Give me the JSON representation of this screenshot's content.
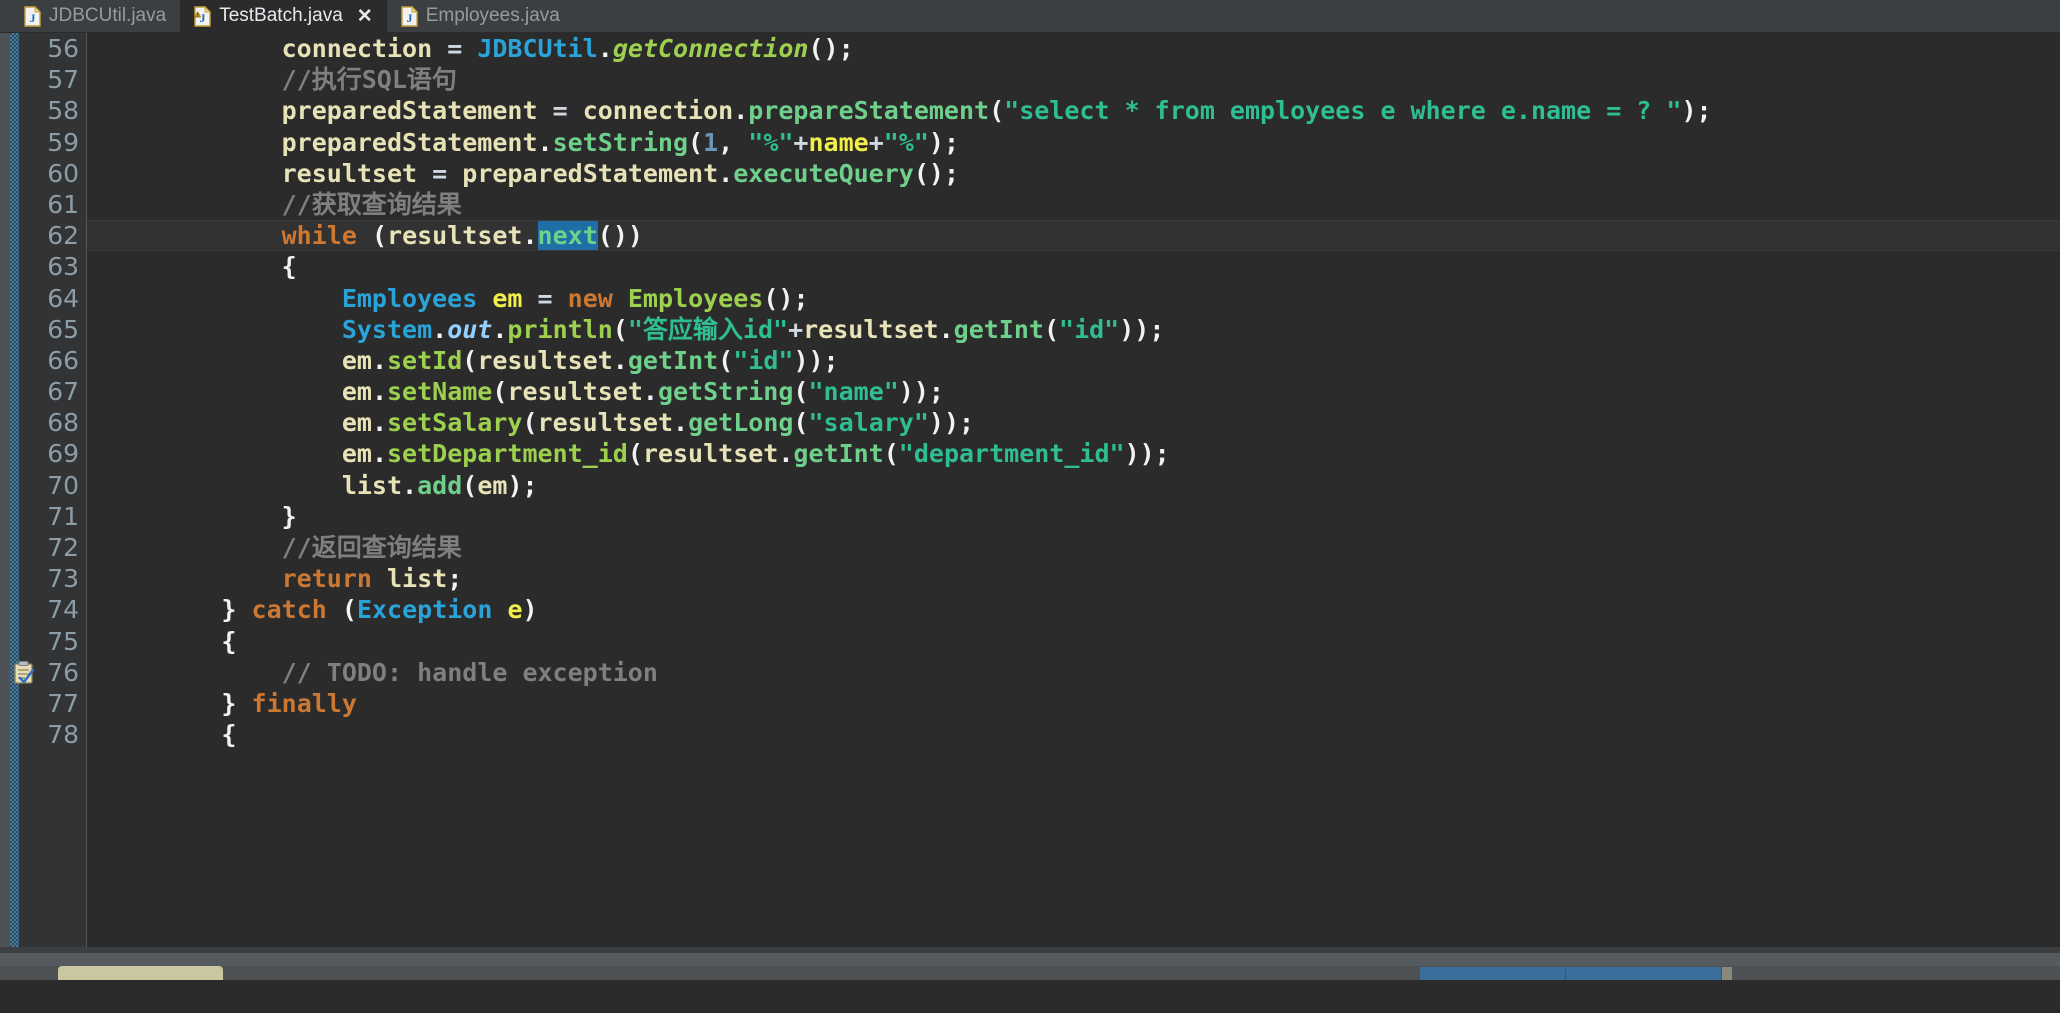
{
  "window": {
    "kind": "java-ide-editor",
    "background": "#2b2b2b"
  },
  "tabs": [
    {
      "label": "JDBCUtil.java",
      "icon": "java-file-icon",
      "active": false,
      "warning": false,
      "closable": false
    },
    {
      "label": "TestBatch.java",
      "icon": "java-file-warning-icon",
      "active": true,
      "warning": true,
      "closable": true,
      "close_label": "✕"
    },
    {
      "label": "Employees.java",
      "icon": "java-file-icon",
      "active": false,
      "warning": false,
      "closable": false
    }
  ],
  "gutter": {
    "first_line": 56,
    "last_line": 78,
    "lines": [
      "56",
      "57",
      "58",
      "59",
      "60",
      "61",
      "62",
      "63",
      "64",
      "65",
      "66",
      "67",
      "68",
      "69",
      "70",
      "71",
      "72",
      "73",
      "74",
      "75",
      "76",
      "77",
      "78"
    ],
    "todo_marker_line": "76"
  },
  "editor": {
    "caret_line": "62",
    "selection_text": "next",
    "language": "Java",
    "lines": [
      {
        "n": "56",
        "tokens": [
          {
            "t": "            ",
            "c": "plain"
          },
          {
            "t": "connection",
            "c": "var"
          },
          {
            "t": " ",
            "c": "plain"
          },
          {
            "t": "=",
            "c": "op"
          },
          {
            "t": " ",
            "c": "plain"
          },
          {
            "t": "JDBCUtil",
            "c": "cls"
          },
          {
            "t": ".",
            "c": "punc"
          },
          {
            "t": "getConnection",
            "c": "meth-italic"
          },
          {
            "t": "();",
            "c": "punc"
          }
        ]
      },
      {
        "n": "57",
        "tokens": [
          {
            "t": "            ",
            "c": "plain"
          },
          {
            "t": "//执行SQL语句",
            "c": "cmt"
          }
        ]
      },
      {
        "n": "58",
        "tokens": [
          {
            "t": "            ",
            "c": "plain"
          },
          {
            "t": "preparedStatement",
            "c": "var"
          },
          {
            "t": " ",
            "c": "plain"
          },
          {
            "t": "=",
            "c": "op"
          },
          {
            "t": " ",
            "c": "plain"
          },
          {
            "t": "connection",
            "c": "var"
          },
          {
            "t": ".",
            "c": "punc"
          },
          {
            "t": "prepareStatement",
            "c": "mcall"
          },
          {
            "t": "(",
            "c": "punc"
          },
          {
            "t": "\"select * from employees e where e.name = ? \"",
            "c": "str"
          },
          {
            "t": ");",
            "c": "punc"
          }
        ]
      },
      {
        "n": "59",
        "tokens": [
          {
            "t": "            ",
            "c": "plain"
          },
          {
            "t": "preparedStatement",
            "c": "var"
          },
          {
            "t": ".",
            "c": "punc"
          },
          {
            "t": "setString",
            "c": "mcall"
          },
          {
            "t": "(",
            "c": "punc"
          },
          {
            "t": "1",
            "c": "num"
          },
          {
            "t": ", ",
            "c": "punc"
          },
          {
            "t": "\"%\"",
            "c": "str"
          },
          {
            "t": "+",
            "c": "op"
          },
          {
            "t": "name",
            "c": "param"
          },
          {
            "t": "+",
            "c": "op"
          },
          {
            "t": "\"%\"",
            "c": "str"
          },
          {
            "t": ");",
            "c": "punc"
          }
        ]
      },
      {
        "n": "60",
        "tokens": [
          {
            "t": "            ",
            "c": "plain"
          },
          {
            "t": "resultset",
            "c": "var"
          },
          {
            "t": " ",
            "c": "plain"
          },
          {
            "t": "=",
            "c": "op"
          },
          {
            "t": " ",
            "c": "plain"
          },
          {
            "t": "preparedStatement",
            "c": "var"
          },
          {
            "t": ".",
            "c": "punc"
          },
          {
            "t": "executeQuery",
            "c": "mcall"
          },
          {
            "t": "();",
            "c": "punc"
          }
        ]
      },
      {
        "n": "61",
        "tokens": [
          {
            "t": "            ",
            "c": "plain"
          },
          {
            "t": "//获取查询结果",
            "c": "cmt"
          }
        ]
      },
      {
        "n": "62",
        "caret": true,
        "tokens": [
          {
            "t": "            ",
            "c": "plain"
          },
          {
            "t": "while",
            "c": "kw"
          },
          {
            "t": " ",
            "c": "plain"
          },
          {
            "t": "(",
            "c": "punc"
          },
          {
            "t": "resultset",
            "c": "var"
          },
          {
            "t": ".",
            "c": "punc"
          },
          {
            "t": "next",
            "c": "selected"
          },
          {
            "t": "())",
            "c": "punc"
          }
        ]
      },
      {
        "n": "63",
        "tokens": [
          {
            "t": "            ",
            "c": "plain"
          },
          {
            "t": "{",
            "c": "punc"
          }
        ]
      },
      {
        "n": "64",
        "tokens": [
          {
            "t": "                ",
            "c": "plain"
          },
          {
            "t": "Employees",
            "c": "cls"
          },
          {
            "t": " ",
            "c": "plain"
          },
          {
            "t": "em",
            "c": "param"
          },
          {
            "t": " ",
            "c": "plain"
          },
          {
            "t": "=",
            "c": "op"
          },
          {
            "t": " ",
            "c": "plain"
          },
          {
            "t": "new",
            "c": "kw"
          },
          {
            "t": " ",
            "c": "plain"
          },
          {
            "t": "Employees",
            "c": "meth"
          },
          {
            "t": "();",
            "c": "punc"
          }
        ]
      },
      {
        "n": "65",
        "tokens": [
          {
            "t": "                ",
            "c": "plain"
          },
          {
            "t": "System",
            "c": "cls"
          },
          {
            "t": ".",
            "c": "punc"
          },
          {
            "t": "out",
            "c": "stat"
          },
          {
            "t": ".",
            "c": "punc"
          },
          {
            "t": "println",
            "c": "meth"
          },
          {
            "t": "(",
            "c": "punc"
          },
          {
            "t": "\"答应输入id\"",
            "c": "str"
          },
          {
            "t": "+",
            "c": "op"
          },
          {
            "t": "resultset",
            "c": "var"
          },
          {
            "t": ".",
            "c": "punc"
          },
          {
            "t": "getInt",
            "c": "mcall"
          },
          {
            "t": "(",
            "c": "punc"
          },
          {
            "t": "\"id\"",
            "c": "str"
          },
          {
            "t": "));",
            "c": "punc"
          }
        ]
      },
      {
        "n": "66",
        "tokens": [
          {
            "t": "                ",
            "c": "plain"
          },
          {
            "t": "em",
            "c": "var"
          },
          {
            "t": ".",
            "c": "punc"
          },
          {
            "t": "setId",
            "c": "meth"
          },
          {
            "t": "(",
            "c": "punc"
          },
          {
            "t": "resultset",
            "c": "var"
          },
          {
            "t": ".",
            "c": "punc"
          },
          {
            "t": "getInt",
            "c": "mcall"
          },
          {
            "t": "(",
            "c": "punc"
          },
          {
            "t": "\"id\"",
            "c": "str"
          },
          {
            "t": "));",
            "c": "punc"
          }
        ]
      },
      {
        "n": "67",
        "tokens": [
          {
            "t": "                ",
            "c": "plain"
          },
          {
            "t": "em",
            "c": "var"
          },
          {
            "t": ".",
            "c": "punc"
          },
          {
            "t": "setName",
            "c": "meth"
          },
          {
            "t": "(",
            "c": "punc"
          },
          {
            "t": "resultset",
            "c": "var"
          },
          {
            "t": ".",
            "c": "punc"
          },
          {
            "t": "getString",
            "c": "mcall"
          },
          {
            "t": "(",
            "c": "punc"
          },
          {
            "t": "\"name\"",
            "c": "str"
          },
          {
            "t": "));",
            "c": "punc"
          }
        ]
      },
      {
        "n": "68",
        "tokens": [
          {
            "t": "                ",
            "c": "plain"
          },
          {
            "t": "em",
            "c": "var"
          },
          {
            "t": ".",
            "c": "punc"
          },
          {
            "t": "setSalary",
            "c": "meth"
          },
          {
            "t": "(",
            "c": "punc"
          },
          {
            "t": "resultset",
            "c": "var"
          },
          {
            "t": ".",
            "c": "punc"
          },
          {
            "t": "getLong",
            "c": "mcall"
          },
          {
            "t": "(",
            "c": "punc"
          },
          {
            "t": "\"salary\"",
            "c": "str"
          },
          {
            "t": "));",
            "c": "punc"
          }
        ]
      },
      {
        "n": "69",
        "tokens": [
          {
            "t": "                ",
            "c": "plain"
          },
          {
            "t": "em",
            "c": "var"
          },
          {
            "t": ".",
            "c": "punc"
          },
          {
            "t": "setDepartment_id",
            "c": "meth"
          },
          {
            "t": "(",
            "c": "punc"
          },
          {
            "t": "resultset",
            "c": "var"
          },
          {
            "t": ".",
            "c": "punc"
          },
          {
            "t": "getInt",
            "c": "mcall"
          },
          {
            "t": "(",
            "c": "punc"
          },
          {
            "t": "\"department_id\"",
            "c": "str"
          },
          {
            "t": "));",
            "c": "punc"
          }
        ]
      },
      {
        "n": "70",
        "tokens": [
          {
            "t": "                ",
            "c": "plain"
          },
          {
            "t": "list",
            "c": "var"
          },
          {
            "t": ".",
            "c": "punc"
          },
          {
            "t": "add",
            "c": "mcall"
          },
          {
            "t": "(",
            "c": "punc"
          },
          {
            "t": "em",
            "c": "var"
          },
          {
            "t": ");",
            "c": "punc"
          }
        ]
      },
      {
        "n": "71",
        "tokens": [
          {
            "t": "            ",
            "c": "plain"
          },
          {
            "t": "}",
            "c": "punc"
          }
        ]
      },
      {
        "n": "72",
        "tokens": [
          {
            "t": "            ",
            "c": "plain"
          },
          {
            "t": "//返回查询结果",
            "c": "cmt"
          }
        ]
      },
      {
        "n": "73",
        "tokens": [
          {
            "t": "            ",
            "c": "plain"
          },
          {
            "t": "return",
            "c": "kw"
          },
          {
            "t": " ",
            "c": "plain"
          },
          {
            "t": "list",
            "c": "var"
          },
          {
            "t": ";",
            "c": "punc"
          }
        ]
      },
      {
        "n": "74",
        "tokens": [
          {
            "t": "        ",
            "c": "plain"
          },
          {
            "t": "}",
            "c": "punc"
          },
          {
            "t": " ",
            "c": "plain"
          },
          {
            "t": "catch",
            "c": "kw"
          },
          {
            "t": " ",
            "c": "plain"
          },
          {
            "t": "(",
            "c": "punc"
          },
          {
            "t": "Exception",
            "c": "cls"
          },
          {
            "t": " ",
            "c": "plain"
          },
          {
            "t": "e",
            "c": "param"
          },
          {
            "t": ")",
            "c": "punc"
          }
        ]
      },
      {
        "n": "75",
        "tokens": [
          {
            "t": "        ",
            "c": "plain"
          },
          {
            "t": "{",
            "c": "punc"
          }
        ]
      },
      {
        "n": "76",
        "tokens": [
          {
            "t": "            ",
            "c": "plain"
          },
          {
            "t": "// TODO: handle exception",
            "c": "cmt"
          }
        ]
      },
      {
        "n": "77",
        "tokens": [
          {
            "t": "        ",
            "c": "plain"
          },
          {
            "t": "}",
            "c": "punc"
          },
          {
            "t": " ",
            "c": "plain"
          },
          {
            "t": "finally",
            "c": "kw"
          }
        ]
      },
      {
        "n": "78",
        "tokens": [
          {
            "t": "        ",
            "c": "plain"
          },
          {
            "t": "{",
            "c": "punc"
          }
        ]
      }
    ]
  },
  "colors": {
    "editor_bg": "#2b2b2b",
    "gutter_bg": "#313335",
    "tabbar_bg": "#3c3f41",
    "caret_line_bg": "#323232",
    "selection_bg": "#1d6fa5",
    "keyword": "#cc7832",
    "string": "#2fbd92",
    "comment": "#7f7f7f",
    "class_name": "#2aa3d8",
    "method": "#9ed04f",
    "number": "#6897bb",
    "variable": "#e8e2b7",
    "change_marker": "#3c7ca8"
  }
}
